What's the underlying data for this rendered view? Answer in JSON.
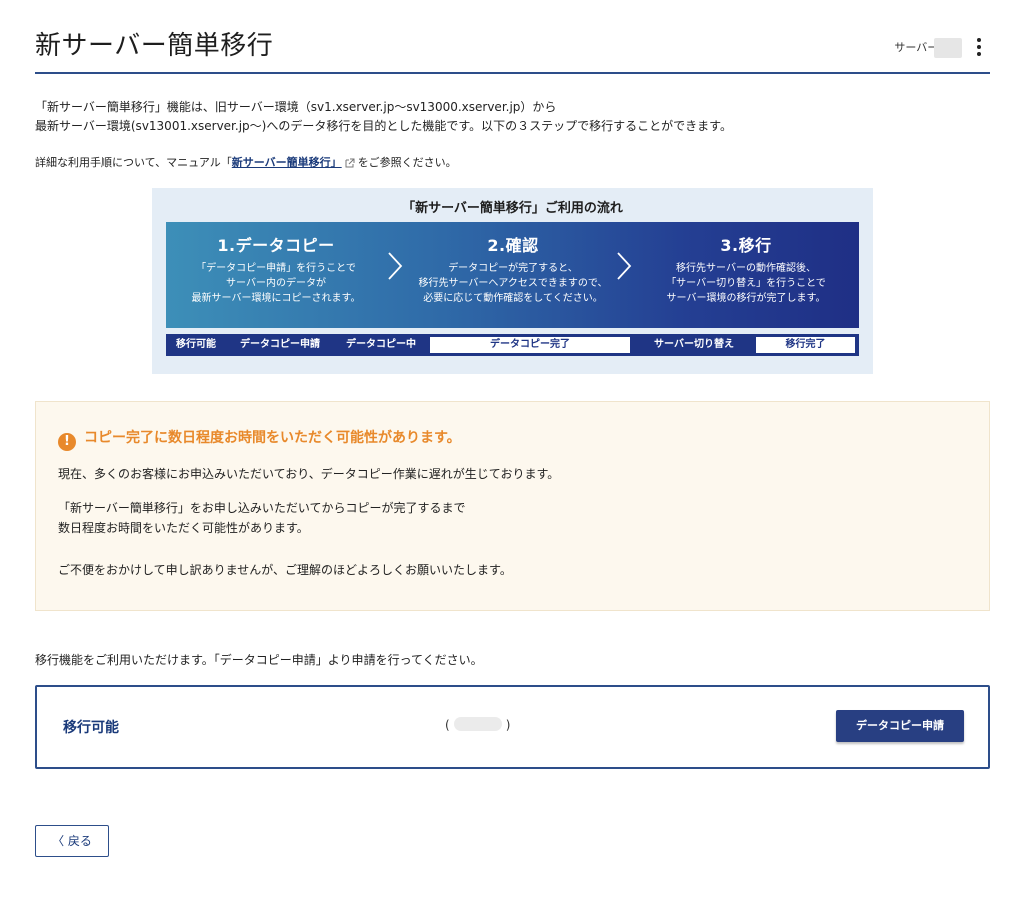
{
  "header": {
    "title": "新サーバー簡単移行",
    "server_id_label": "サーバーID"
  },
  "intro": {
    "line1": "「新サーバー簡単移行」機能は、旧サーバー環境（sv1.xserver.jp〜sv13000.xserver.jp）から",
    "line2": "最新サーバー環境(sv13001.xserver.jp〜)へのデータ移行を目的とした機能です。以下の３ステップで移行することができます。"
  },
  "manual": {
    "prefix": "詳細な利用手順について、マニュアル「",
    "link": "新サーバー簡単移行」",
    "suffix": "をご参照ください。"
  },
  "flow": {
    "title": "「新サーバー簡単移行」ご利用の流れ",
    "steps": [
      {
        "title": "1.データコピー",
        "desc1": "「データコピー申請」を行うことで",
        "desc2": "サーバー内のデータが",
        "desc3": "最新サーバー環境にコピーされます。"
      },
      {
        "title": "2.確認",
        "desc1": "データコピーが完了すると、",
        "desc2": "移行先サーバーへアクセスできますので、",
        "desc3": "必要に応じて動作確認をしてください。"
      },
      {
        "title": "3.移行",
        "desc1": "移行先サーバーの動作確認後、",
        "desc2": "「サーバー切り替え」を行うことで",
        "desc3": "サーバー環境の移行が完了します。"
      }
    ],
    "stages": [
      "移行可能",
      "データコピー申請",
      "データコピー中",
      "データコピー完了",
      "サーバー切り替え",
      "移行完了"
    ]
  },
  "notice": {
    "heading": "コピー完了に数日程度お時間をいただく可能性があります。",
    "p1": "現在、多くのお客様にお申込みいただいており、データコピー作業に遅れが生じております。",
    "p2a": "「新サーバー簡単移行」をお申し込みいただいてからコピーが完了するまで",
    "p2b": "数日程度お時間をいただく可能性があります。",
    "p3": "ご不便をおかけして申し訳ありませんが、ご理解のほどよろしくお願いいたします。"
  },
  "available_text": "移行機能をご利用いただけます。「データコピー申請」より申請を行ってください。",
  "panel": {
    "status": "移行可能",
    "paren_open": "(",
    "paren_close": ")",
    "button": "データコピー申請"
  },
  "back_button": "〈 戻る",
  "colors": {
    "accent": "#2d4e8a",
    "button": "#283f82",
    "warning": "#e8892b",
    "notice_bg": "#fdf8ee"
  }
}
